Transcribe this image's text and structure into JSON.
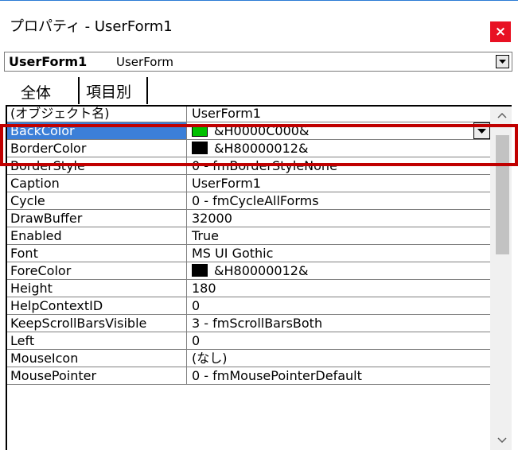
{
  "window": {
    "title": "プロパティ - UserForm1",
    "close_label": "×"
  },
  "object_selector": {
    "name": "UserForm1",
    "type": "UserForm"
  },
  "tabs": [
    {
      "label": "全体"
    },
    {
      "label": "項目別"
    }
  ],
  "properties": [
    {
      "name": "(オブジェクト名)",
      "value": "UserForm1"
    },
    {
      "name": "BackColor",
      "value": "&H0000C000&",
      "swatch": "#00c000"
    },
    {
      "name": "BorderColor",
      "value": "&H80000012&",
      "swatch": "#000000"
    },
    {
      "name": "BorderStyle",
      "value": "0 - fmBorderStyleNone"
    },
    {
      "name": "Caption",
      "value": "UserForm1"
    },
    {
      "name": "Cycle",
      "value": "0 - fmCycleAllForms"
    },
    {
      "name": "DrawBuffer",
      "value": "32000"
    },
    {
      "name": "Enabled",
      "value": "True"
    },
    {
      "name": "Font",
      "value": "MS UI Gothic"
    },
    {
      "name": "ForeColor",
      "value": "&H80000012&",
      "swatch": "#000000"
    },
    {
      "name": "Height",
      "value": "180"
    },
    {
      "name": "HelpContextID",
      "value": "0"
    },
    {
      "name": "KeepScrollBarsVisible",
      "value": "3 - fmScrollBarsBoth"
    },
    {
      "name": "Left",
      "value": "0"
    },
    {
      "name": "MouseIcon",
      "value": "(なし)"
    },
    {
      "name": "MousePointer",
      "value": "0 - fmMousePointerDefault"
    }
  ],
  "selected_property": "BackColor",
  "colors": {
    "selection": "#3c7fd8",
    "close_button": "#e81123",
    "highlight_box": "#c00000"
  }
}
